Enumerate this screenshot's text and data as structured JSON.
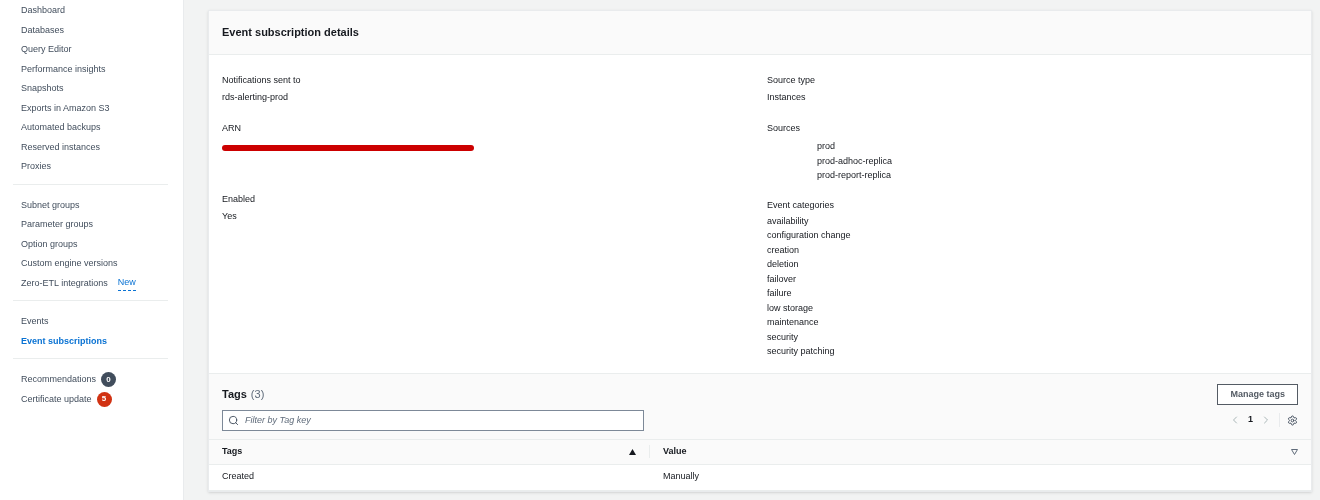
{
  "sidebar": {
    "groups": [
      {
        "items": [
          {
            "label": "Dashboard",
            "selected": false
          },
          {
            "label": "Databases",
            "selected": false
          },
          {
            "label": "Query Editor",
            "selected": false
          },
          {
            "label": "Performance insights",
            "selected": false
          },
          {
            "label": "Snapshots",
            "selected": false
          },
          {
            "label": "Exports in Amazon S3",
            "selected": false
          },
          {
            "label": "Automated backups",
            "selected": false
          },
          {
            "label": "Reserved instances",
            "selected": false
          },
          {
            "label": "Proxies",
            "selected": false
          }
        ]
      },
      {
        "items": [
          {
            "label": "Subnet groups",
            "selected": false
          },
          {
            "label": "Parameter groups",
            "selected": false
          },
          {
            "label": "Option groups",
            "selected": false
          },
          {
            "label": "Custom engine versions",
            "selected": false
          },
          {
            "label": "Zero-ETL integrations",
            "selected": false,
            "tag": "New"
          }
        ]
      },
      {
        "items": [
          {
            "label": "Events",
            "selected": false
          },
          {
            "label": "Event subscriptions",
            "selected": true
          }
        ]
      },
      {
        "items": [
          {
            "label": "Recommendations",
            "selected": false,
            "count": "0",
            "color": "#414d5c"
          },
          {
            "label": "Certificate update",
            "selected": false,
            "count": "5",
            "color": "#d13212"
          }
        ]
      }
    ]
  },
  "details": {
    "title": "Event subscription details",
    "left": [
      {
        "label": "Notifications sent to",
        "kind": "text",
        "value": "rds-alerting-prod"
      },
      {
        "label": "ARN",
        "kind": "redacted"
      },
      {
        "label": "Enabled",
        "kind": "text",
        "value": "Yes"
      }
    ],
    "right": [
      {
        "label": "Source type",
        "kind": "text",
        "value": "Instances"
      },
      {
        "label": "Sources",
        "kind": "indented",
        "values": [
          "prod",
          "prod-adhoc-replica",
          "prod-report-replica"
        ]
      },
      {
        "label": "Event categories",
        "kind": "list",
        "values": [
          "availability",
          "configuration change",
          "creation",
          "deletion",
          "failover",
          "failure",
          "low storage",
          "maintenance",
          "security",
          "security patching"
        ]
      }
    ]
  },
  "tags": {
    "title": "Tags",
    "count": "(3)",
    "manage_button": "Manage tags",
    "filter": {
      "placeholder": "Filter by Tag key"
    },
    "page": "1",
    "columns": [
      "Tags",
      "Value"
    ],
    "rows": [
      [
        "Created",
        "Manually"
      ]
    ]
  }
}
